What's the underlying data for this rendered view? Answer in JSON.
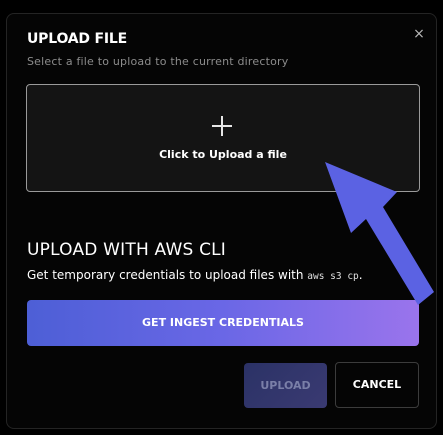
{
  "dialog": {
    "title": "UPLOAD FILE",
    "subtitle": "Select a file to upload to the current directory",
    "close_glyph": "×"
  },
  "dropzone": {
    "icon": "plus-icon",
    "label": "Click to Upload a file"
  },
  "cli_section": {
    "title": "UPLOAD WITH AWS CLI",
    "text": "Get temporary credentials to upload files with ",
    "command": "aws s3 cp",
    "text_end": ".",
    "button_label": "GET INGEST CREDENTIALS"
  },
  "footer": {
    "upload_label": "UPLOAD",
    "cancel_label": "CANCEL"
  },
  "colors": {
    "background": "#000000",
    "modal_background": "#050505",
    "accent_gradient_start": "#4d5fd6",
    "accent_gradient_end": "#9a74ec",
    "annotation_arrow": "#5b62e3"
  }
}
